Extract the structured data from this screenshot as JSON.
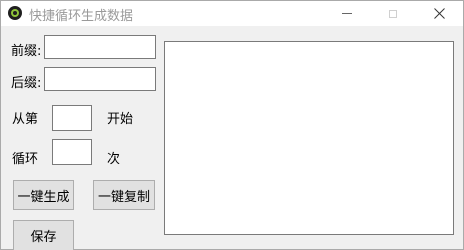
{
  "window": {
    "title": "快捷循环生成数据"
  },
  "form": {
    "prefix_label": "前缀:",
    "prefix_value": "",
    "suffix_label": "后缀:",
    "suffix_value": "",
    "from_label": "从第",
    "start_value": "",
    "start_label": "开始",
    "loop_label": "循环",
    "count_value": "",
    "times_label": "次"
  },
  "buttons": {
    "generate": "一键生成",
    "copy": "一键复制",
    "save": "保存"
  },
  "output": {
    "text": ""
  },
  "colors": {
    "background": "#f0f0f0",
    "button_face": "#e1e1e1",
    "border": "#7a7a7a",
    "title_text": "#9a9a9a",
    "icon_accent": "#8fc43a"
  }
}
